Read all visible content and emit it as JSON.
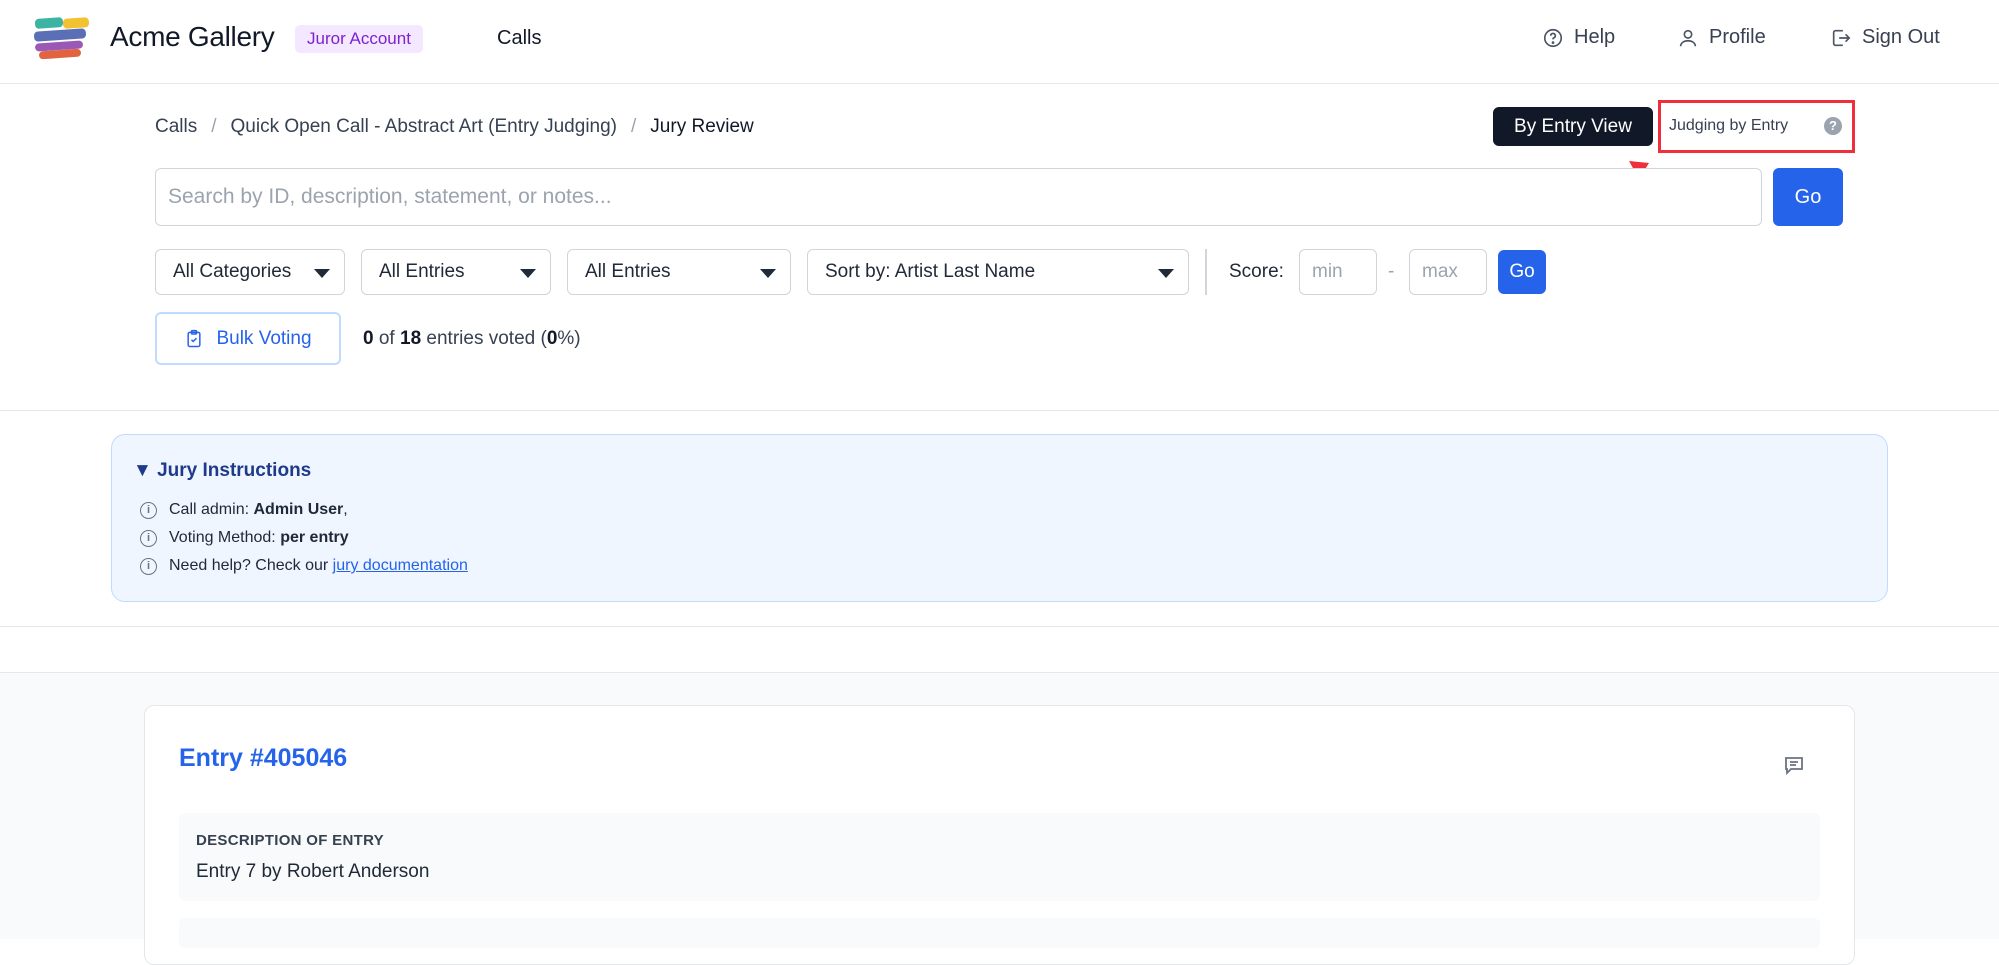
{
  "header": {
    "brand": "Acme Gallery",
    "badge": "Juror Account",
    "nav_calls": "Calls",
    "help": "Help",
    "profile": "Profile",
    "sign_out": "Sign Out",
    "logo_colors": [
      "#3cb4a4",
      "#f2c230",
      "#5b6fb6",
      "#e2633f"
    ]
  },
  "breadcrumb": {
    "calls": "Calls",
    "call": "Quick Open Call - Abstract Art (Entry Judging)",
    "current": "Jury Review",
    "separator": "/"
  },
  "view_toggle": {
    "label": "By Entry View",
    "mode": "Judging by Entry",
    "help": "?"
  },
  "search": {
    "placeholder": "Search by ID, description, statement, or notes...",
    "value": "",
    "go": "Go"
  },
  "filters": {
    "category": "All Categories",
    "entries_1": "All Entries",
    "entries_2": "All Entries",
    "sort": "Sort by: Artist Last Name",
    "score_label": "Score:",
    "min_placeholder": "min",
    "max_placeholder": "max",
    "dash": "-",
    "go": "Go"
  },
  "voting": {
    "bulk_label": "Bulk Voting",
    "voted": "0",
    "of": "of",
    "total": "18",
    "entries_voted": "entries voted (",
    "percent": "0",
    "percent_suffix": "%)"
  },
  "jury": {
    "title": "Jury Instructions",
    "admin_label": "Call admin:",
    "admin_name": "Admin User",
    "admin_suffix": ",",
    "method_label": "Voting Method:",
    "method": "per entry",
    "help_label": "Need help? Check our",
    "help_link": "jury documentation"
  },
  "entry": {
    "title": "Entry #405046",
    "desc_label": "DESCRIPTION OF ENTRY",
    "desc_text": "Entry 7 by Robert Anderson"
  },
  "colors": {
    "primary": "#2563eb",
    "dark": "#111827",
    "highlight": "#ef2f3c",
    "badge_bg": "#f3e8ff",
    "badge_text": "#7e22ce"
  }
}
